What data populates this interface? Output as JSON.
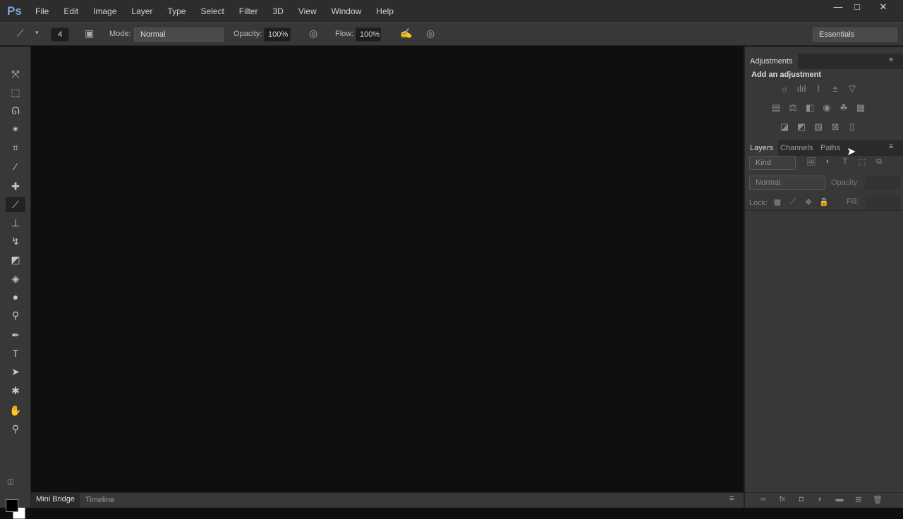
{
  "app": {
    "logo": "Ps"
  },
  "menu": [
    "File",
    "Edit",
    "Image",
    "Layer",
    "Type",
    "Select",
    "Filter",
    "3D",
    "View",
    "Window",
    "Help"
  ],
  "window_controls": {
    "minimize": "—",
    "maximize": "□",
    "close": "✕"
  },
  "options": {
    "brush_size": "4",
    "mode_label": "Mode:",
    "mode_value": "Normal",
    "opacity_label": "Opacity:",
    "opacity_value": "100%",
    "flow_label": "Flow:",
    "flow_value": "100%",
    "workspace": "Essentials"
  },
  "tools": [
    {
      "name": "move-tool",
      "glyph": "⤧"
    },
    {
      "name": "marquee-tool",
      "glyph": "⬚"
    },
    {
      "name": "lasso-tool",
      "glyph": "ᘏ"
    },
    {
      "name": "magic-wand-tool",
      "glyph": "✴"
    },
    {
      "name": "crop-tool",
      "glyph": "⌗"
    },
    {
      "name": "eyedropper-tool",
      "glyph": "⁄"
    },
    {
      "name": "healing-brush-tool",
      "glyph": "✚"
    },
    {
      "name": "brush-tool",
      "glyph": "⟋"
    },
    {
      "name": "clone-stamp-tool",
      "glyph": "⊥"
    },
    {
      "name": "history-brush-tool",
      "glyph": "↯"
    },
    {
      "name": "eraser-tool",
      "glyph": "◩"
    },
    {
      "name": "paint-bucket-tool",
      "glyph": "◈"
    },
    {
      "name": "blur-tool",
      "glyph": "●"
    },
    {
      "name": "dodge-tool",
      "glyph": "⚲"
    },
    {
      "name": "pen-tool",
      "glyph": "✒"
    },
    {
      "name": "type-tool",
      "glyph": "T"
    },
    {
      "name": "path-selection-tool",
      "glyph": "➤"
    },
    {
      "name": "shape-tool",
      "glyph": "✱"
    },
    {
      "name": "hand-tool",
      "glyph": "✋"
    },
    {
      "name": "zoom-tool",
      "glyph": "⚲"
    }
  ],
  "active_tool": "brush-tool",
  "colors": {
    "foreground": "#000000",
    "background": "#ffffff",
    "accent": "#7fa3d6"
  },
  "bottom_tabs": [
    "Mini Bridge",
    "Timeline"
  ],
  "adjustments": {
    "tab": "Adjustments",
    "heading": "Add an adjustment",
    "rows": [
      [
        "☼",
        "ılıl",
        "⌇",
        "±",
        "▽"
      ],
      [
        "▤",
        "⚖",
        "◧",
        "◉",
        "☘",
        "▦"
      ],
      [
        "◪",
        "◩",
        "▨",
        "⊠",
        "▯"
      ]
    ]
  },
  "layers": {
    "tabs": [
      "Layers",
      "Channels",
      "Paths"
    ],
    "filter_kind": "Kind",
    "filter_icons": [
      "🖼",
      "◐",
      "T",
      "⬚",
      "⧉"
    ],
    "blend_mode": "Normal",
    "opacity_label": "Opacity:",
    "lock_label": "Lock:",
    "lock_icons": [
      "▩",
      "⟋",
      "✥",
      "🔒"
    ],
    "fill_label": "Fill:",
    "footer_icons": [
      "∞",
      "fx",
      "◘",
      "◐",
      "▬",
      "⊞",
      "🗑"
    ]
  }
}
